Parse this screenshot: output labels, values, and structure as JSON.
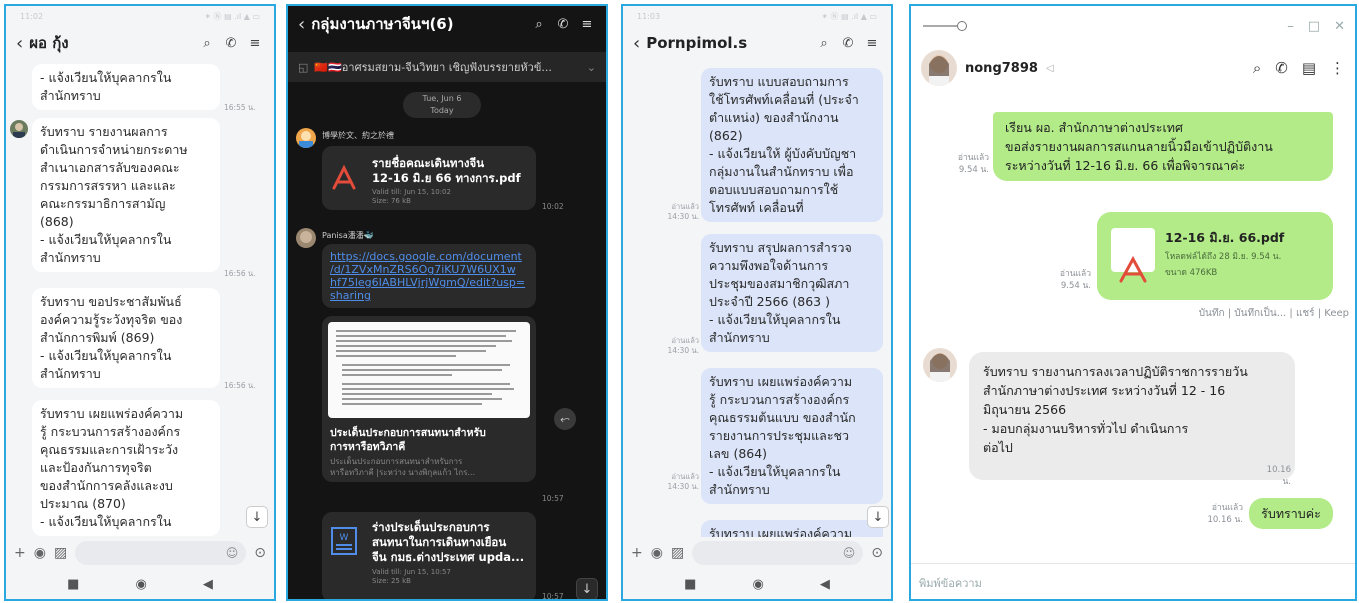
{
  "colors": {
    "border": "#29a9e0",
    "line_green": "#b2eb88",
    "sent_blue": "#dbe4f8",
    "pdf_red": "#e34b3b",
    "link_blue": "#4f8de8"
  },
  "p1": {
    "status_time": "11:02",
    "status_right": "✶ Ⓝ ▤ .ıl ▲ ▭",
    "title": "ผอ กุ้ง",
    "icons": [
      "search-icon",
      "phone-icon",
      "menu-icon"
    ],
    "messages": [
      {
        "text": "- แจ้งเวียนให้บุคลากรใน\nสำนักทราบ",
        "time": "16:55 น."
      },
      {
        "text": "รับทราบ รายงานผลการ\nดำเนินการจำหน่ายกระดาษ\nสำเนาเอกสารลับของคณะ\nกรรมการสรรหา และและ\nคณะกรรมาธิการสามัญ\n(868)\n- แจ้งเวียนให้บุคลากรใน\nสำนักทราบ",
        "time": "16:56 น."
      },
      {
        "text": "รับทราบ ขอประชาสัมพันธ์\nองค์ความรู้ระวังทุจริต ของ\nสำนักการพิมพ์ (869)\n- แจ้งเวียนให้บุคลากรใน\nสำนักทราบ",
        "time": "16:56 น."
      },
      {
        "text": "รับทราบ เผยแพร่องค์ความ\nรู้ กระบวนการสร้างองค์กร\nคุณธรรมและการเฝ้าระวัง\nและป้องกันการทุจริต\nของสำนักการคลังและงบ\nประมาณ (870)\n- แจ้งเวียนให้บุคลากรใน",
        "time": ""
      }
    ]
  },
  "p2": {
    "title": "กลุ่มงานภาษาจีนฯ(6)",
    "announcement": "🇨🇳🇹🇭อาศรมสยาม-จีนวิทยา เชิญฟังบรรยายหัวข้...",
    "date": "Tue, Jun 6",
    "today": "Today",
    "sender1": "博學於文、約之於禮",
    "file1": {
      "name": "รายชื่อคณะเดินทางจีน\n12-16 มิ.ย 66 ทางการ.pdf",
      "meta": "Valid till: Jun 15, 10:02\nSize: 76 kB",
      "time": "10:02"
    },
    "sender2": "Panisa潘潘🐳",
    "link": "https://docs.google.com/document\n/d/1ZVxMnZRS6Og7iKU7W6UX1w\nhf75leg6IABHLVjrjWgmQ/edit?usp=\nsharing",
    "preview_title": "ประเด็นประกอบการสนทนาสำหรับ\nการหารือทวิภาคี",
    "preview_desc": "ประเด็นประกอบการสนทนาสำหรับการ\nหารือทวิภาคี |ระหว่าง นางพิกุลแก้ว ไกร...",
    "preview_time": "10:57",
    "file2": {
      "name": "ร่างประเด็นประกอบการ\nสนทนาในการเดินทางเยือน\nจีน กมธ.ต่างประเทศ upda...",
      "meta": "Valid till: Jun 15, 10:57\nSize: 25 kB",
      "time": "10:57"
    }
  },
  "p3": {
    "status_time": "11:03",
    "title": "Pornpimol.s",
    "read_label": "อ่านแล้ว",
    "messages": [
      {
        "text": "รับทราบ แบบสอบถามการ\nใช้โทรศัพท์เคลื่อนที่ (ประจำ\nตำแหน่ง) ของสำนักงาน\n(862)\n- แจ้งเวียนให้ ผู้บังคับบัญชา\nกลุ่มงานในสำนักทราบ เพื่อ\nตอบแบบสอบถามการใช้\nโทรศัพท์ เคลื่อนที่",
        "time": "14:30 น."
      },
      {
        "text": "รับทราบ สรุปผลการสำรวจ\nความพึงพอใจด้านการ\nประชุมของสมาชิกวุฒิสภา\nประจำปี 2566 (863 )\n- แจ้งเวียนให้บุคลากรใน\nสำนักทราบ",
        "time": "14:30 น."
      },
      {
        "text": "รับทราบ เผยแพร่องค์ความ\nรู้ กระบวนการสร้างองค์กร\nคุณธรรมต้นแบบ ของสำนัก\nรายงานการประชุมและชว\nเลข (864)\n- แจ้งเวียนให้บุคลากรใน\nสำนักทราบ",
        "time": "14:30 น."
      },
      {
        "text": "รับทราบ เผยแพร่องค์ความ",
        "time": ""
      }
    ]
  },
  "p4": {
    "contact": "nong7898",
    "msg1": {
      "text": "เรียน ผอ. สำนักภาษาต่างประเทศ\nขอส่งรายงานผลการสแกนลายนิ้วมือเข้าปฏิบัติงาน\nระหว่างวันที่ 12-16 มิ.ย. 66 เพื่อพิจารณาค่ะ",
      "read": "อ่านแล้ว",
      "time": "9.54 น."
    },
    "file": {
      "name": "12-16 มิ.ย. 66.pdf",
      "meta": "โหลดฟล์ได้ถึง 28 มิ.ย. 9.54 น.",
      "size": "ขนาด 476KB",
      "read": "อ่านแล้ว",
      "time": "9.54 น."
    },
    "file_actions": "บันทึก | บันทึกเป็น... | แชร์ | Keep",
    "msg2": {
      "text": "รับทราบ รายงานการลงเวลาปฏิบัติราชการรายวัน\nสำนักภาษาต่างประเทศ ระหว่างวันที่ 12 - 16\nมิถุนายน 2566\n- มอบกลุ่มงานบริหารทั่วไป ดำเนินการ\n   ต่อไป",
      "time": "10.16 น."
    },
    "msg3": {
      "text": "รับทราบค่ะ",
      "read": "อ่านแล้ว",
      "time": "10.16 น."
    },
    "input_placeholder": "พิมพ์ข้อความ"
  }
}
